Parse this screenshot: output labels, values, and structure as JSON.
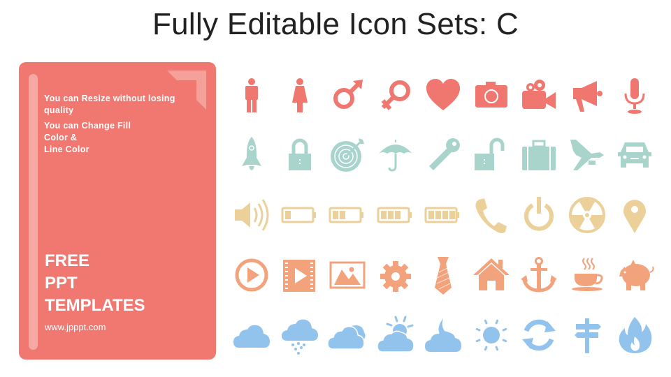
{
  "title": "Fully Editable Icon Sets: C",
  "card": {
    "line1": "You can Resize without losing quality",
    "line2a": "You can Change Fill",
    "line2b": "Color &",
    "line2c": "Line Color",
    "brand1": "FREE",
    "brand2": "PPT",
    "brand3": "TEMPLATES",
    "url": "www.jpppt.com"
  },
  "colors": {
    "card": "#f07870",
    "row1": "#ef7770",
    "row2": "#a8d4cb",
    "row3": "#ecd09a",
    "row4": "#f2a37c",
    "row5": "#92c3ec"
  },
  "icons": [
    [
      "man-icon",
      "woman-icon",
      "male-symbol-icon",
      "female-symbol-icon",
      "heart-icon",
      "camera-icon",
      "video-camera-icon",
      "megaphone-icon",
      "microphone-icon"
    ],
    [
      "rocket-icon",
      "lock-icon",
      "target-icon",
      "umbrella-icon",
      "key-icon",
      "unlock-icon",
      "briefcase-icon",
      "airplane-icon",
      "car-icon"
    ],
    [
      "speaker-icon",
      "battery-low-icon",
      "battery-half-icon",
      "battery-high-icon",
      "battery-full-icon",
      "phone-icon",
      "power-icon",
      "radiation-icon",
      "location-pin-icon"
    ],
    [
      "play-icon",
      "video-icon",
      "image-icon",
      "gear-icon",
      "tie-icon",
      "home-icon",
      "anchor-icon",
      "coffee-icon",
      "piggy-bank-icon"
    ],
    [
      "cloud-icon",
      "rain-icon",
      "clouds-icon",
      "sun-cloud-icon",
      "moon-cloud-icon",
      "sun-icon",
      "refresh-icon",
      "signpost-icon",
      "fire-icon"
    ]
  ]
}
